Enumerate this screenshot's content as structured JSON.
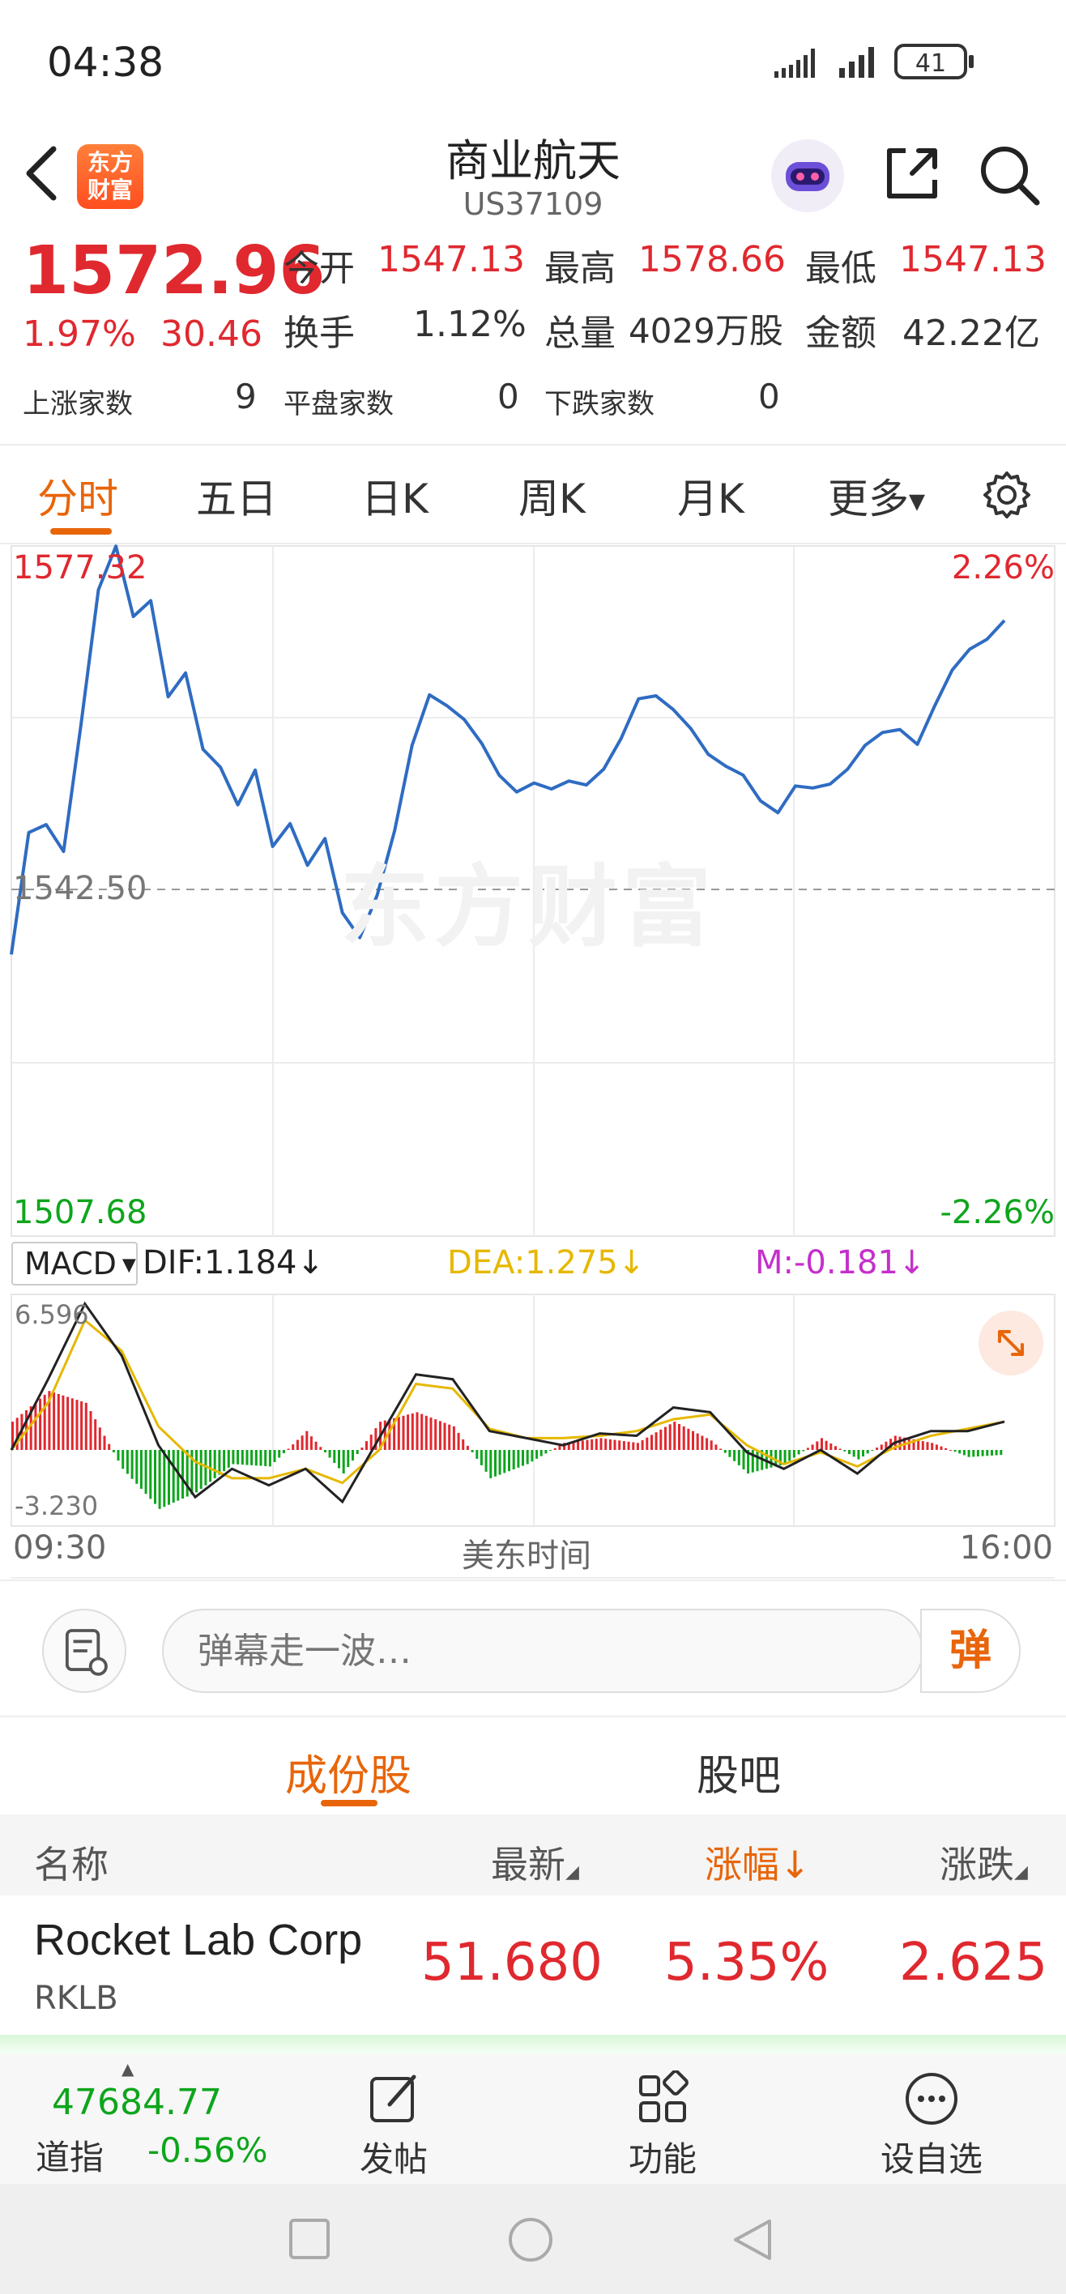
{
  "status_bar": {
    "time": "04:38",
    "battery": "41"
  },
  "header": {
    "title": "商业航天",
    "code": "US37109",
    "logo_line1": "东方",
    "logo_line2": "财富"
  },
  "quote": {
    "price": "1572.96",
    "change_pct": "1.97%",
    "change": "30.46",
    "open_label": "今开",
    "open": "1547.13",
    "high_label": "最高",
    "high": "1578.66",
    "low_label": "最低",
    "low": "1547.13",
    "turnover_label": "换手",
    "turnover": "1.12%",
    "volume_label": "总量",
    "volume": "4029万股",
    "amount_label": "金额",
    "amount": "42.22亿",
    "up_label": "上涨家数",
    "up_count": "9",
    "flat_label": "平盘家数",
    "flat_count": "0",
    "down_label": "下跌家数",
    "down_count": "0"
  },
  "period_tabs": [
    "分时",
    "五日",
    "日K",
    "周K",
    "月K",
    "更多"
  ],
  "chart": {
    "high_label": "1577.32",
    "high_pct": "2.26%",
    "base_label": "1542.50",
    "low_label": "1507.68",
    "low_pct": "-2.26%",
    "watermark": "东方财富",
    "time_start": "09:30",
    "time_mid": "美东时间",
    "time_end": "16:00"
  },
  "macd": {
    "select": "MACD",
    "dif": "DIF:1.184↓",
    "dea": "DEA:1.275↓",
    "m": "M:-0.181↓",
    "max_label": "6.596",
    "min_label": "-3.230"
  },
  "chart_data": {
    "type": "line",
    "x_range": [
      "09:30",
      "16:00"
    ],
    "ylim": [
      1507.68,
      1577.32
    ],
    "baseline": 1542.5,
    "price": [
      1536.1,
      1548.4,
      1549.2,
      1546.5,
      1559.3,
      1572.9,
      1577.3,
      1570.2,
      1571.8,
      1562.1,
      1564.5,
      1556.8,
      1555.0,
      1551.2,
      1554.7,
      1547.0,
      1549.3,
      1545.1,
      1547.8,
      1540.3,
      1537.8,
      1542.1,
      1548.6,
      1557.2,
      1562.3,
      1561.2,
      1559.8,
      1557.4,
      1554.2,
      1552.5,
      1553.4,
      1552.8,
      1553.6,
      1553.2,
      1554.8,
      1557.9,
      1561.9,
      1562.2,
      1560.8,
      1558.9,
      1556.3,
      1555.1,
      1554.2,
      1551.6,
      1550.4,
      1553.1,
      1552.9,
      1553.3,
      1554.8,
      1557.2,
      1558.5,
      1558.8,
      1557.3,
      1561.2,
      1564.8,
      1566.9,
      1567.9,
      1569.8
    ],
    "macd_dif": [
      0.0,
      3.0,
      6.2,
      4.0,
      0.2,
      -2.0,
      -0.8,
      -1.5,
      -0.8,
      -2.2,
      0.5,
      3.2,
      3.0,
      0.8,
      0.5,
      0.2,
      0.7,
      0.6,
      1.8,
      1.6,
      -0.1,
      -0.8,
      0.0,
      -1.0,
      0.3,
      0.8,
      0.8,
      1.2
    ],
    "macd_dea": [
      0.0,
      2.0,
      5.5,
      4.2,
      1.0,
      -0.5,
      -1.2,
      -1.2,
      -0.8,
      -1.4,
      0.0,
      2.8,
      2.6,
      0.9,
      0.5,
      0.5,
      0.6,
      0.8,
      1.3,
      1.5,
      0.2,
      -0.6,
      -0.1,
      -0.7,
      0.1,
      0.6,
      0.9,
      1.2
    ],
    "macd_m": [
      1.2,
      2.5,
      2.0,
      -0.8,
      -2.5,
      -1.8,
      -0.6,
      -0.7,
      0.8,
      -1.0,
      1.2,
      1.6,
      1.0,
      -1.2,
      -0.6,
      0.3,
      0.5,
      0.3,
      1.2,
      0.4,
      -1.0,
      -0.6,
      0.5,
      -0.4,
      0.6,
      0.3,
      -0.3,
      -0.2
    ]
  },
  "comment_bar": {
    "placeholder": "弹幕走一波…",
    "send": "弹"
  },
  "sub_tabs": [
    "成份股",
    "股吧"
  ],
  "table": {
    "headers": [
      "名称",
      "最新",
      "涨幅↓",
      "涨跌"
    ],
    "rows": [
      {
        "name": "Rocket Lab Corp",
        "code": "RKLB",
        "last": "51.680",
        "pct": "5.35%",
        "change": "2.625"
      }
    ]
  },
  "bottom_bar": {
    "index_value": "47684.77",
    "index_name": "道指",
    "index_pct": "-0.56%",
    "post": "发帖",
    "functions": "功能",
    "watchlist": "设自选"
  },
  "colors": {
    "up": "#e0282f",
    "down": "#0ea51c",
    "accent": "#e8650a",
    "line": "#2f6cc2"
  }
}
